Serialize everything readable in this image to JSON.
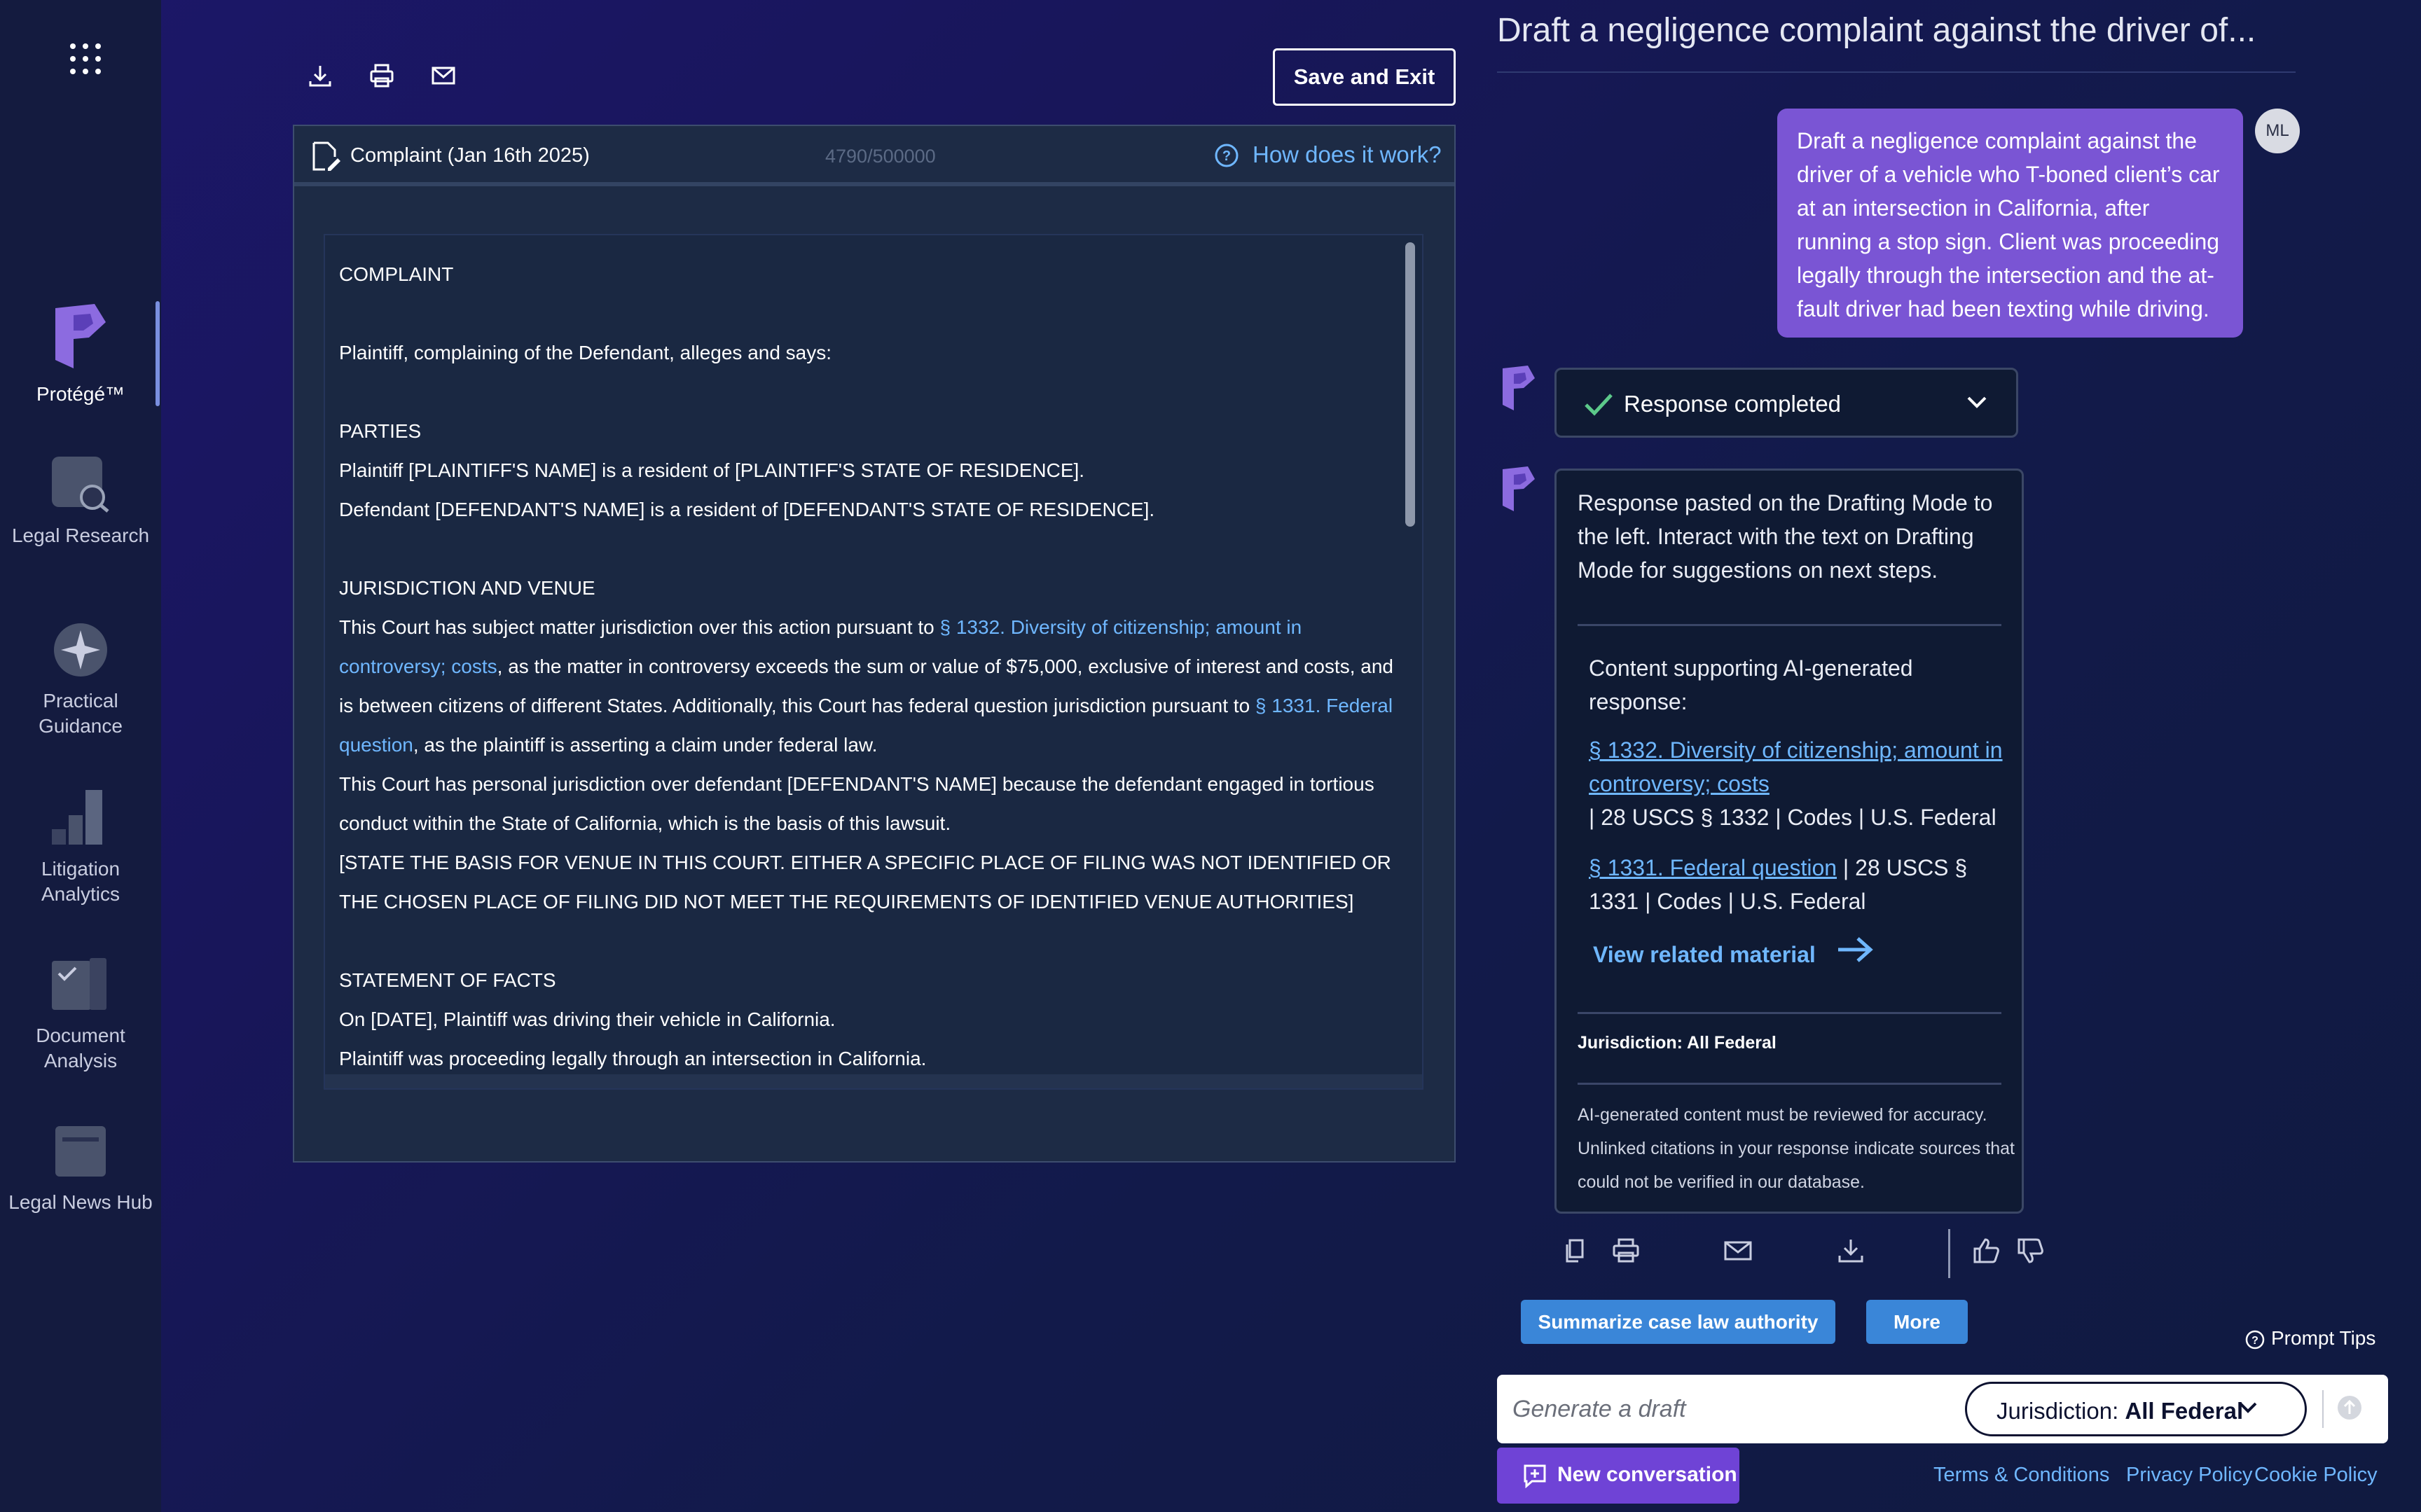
{
  "rail": {
    "items": [
      {
        "label": "Protégé™"
      },
      {
        "label": "Legal Research"
      },
      {
        "label": "Practical Guidance"
      },
      {
        "label": "Litigation Analytics"
      },
      {
        "label": "Document Analysis"
      },
      {
        "label": "Legal News Hub"
      }
    ]
  },
  "toolbar": {
    "download": "download-icon",
    "print": "print-icon",
    "email": "email-icon",
    "save_label": "Save and Exit"
  },
  "editor": {
    "doc_title": "Complaint (Jan 16th 2025)",
    "char_count": "4790/500000",
    "help_link": "How does it work?",
    "text": {
      "heading": "COMPLAINT",
      "intro": "Plaintiff, complaining of the Defendant, alleges and says:",
      "parties_heading": "PARTIES",
      "parties_1": "Plaintiff [PLAINTIFF'S NAME] is a resident of [PLAINTIFF'S STATE OF RESIDENCE].",
      "parties_2": "Defendant [DEFENDANT'S NAME] is a resident of [DEFENDANT'S STATE OF RESIDENCE].",
      "juris_heading": "JURISDICTION AND VENUE",
      "juris_p1_a": "This Court has subject matter jurisdiction over this action pursuant to ",
      "juris_p1_cite1": "§ 1332. Diversity of citizenship; amount in controversy; costs",
      "juris_p1_b": ", as the matter in controversy exceeds the sum or value of $75,000, exclusive of interest and costs, and is between citizens of different States. Additionally, this Court has federal question jurisdiction pursuant to ",
      "juris_p1_cite2": "§ 1331. Federal question",
      "juris_p1_c": ", as the plaintiff is asserting a claim under federal law.",
      "juris_p2": "This Court has personal jurisdiction over defendant [DEFENDANT'S NAME] because the defendant engaged in tortious conduct within the State of California, which is the basis of this lawsuit.",
      "juris_p3": "[STATE THE BASIS FOR VENUE IN THIS COURT. EITHER A SPECIFIC PLACE OF FILING WAS NOT IDENTIFIED OR THE CHOSEN PLACE OF FILING DID NOT MEET THE REQUIREMENTS OF IDENTIFIED VENUE AUTHORITIES]",
      "facts_heading": "STATEMENT OF FACTS",
      "facts_1": "On [DATE], Plaintiff was driving their vehicle in California.",
      "facts_2": "Plaintiff was proceeding legally through an intersection in California."
    }
  },
  "chat": {
    "title": "Draft a negligence complaint against the driver of...",
    "user_initials": "ML",
    "user_message": "Draft a negligence complaint against the driver of a vehicle who T-boned client’s car at an intersection in California, after running a stop sign. Client was proceeding legally through the intersection and the at-fault driver had been texting while driving.",
    "status": "Response completed",
    "response_message": "Response pasted on the Drafting Mode to the left. Interact with the text on Drafting Mode for suggestions on next steps.",
    "support_heading": "Content supporting AI-generated response:",
    "sources": [
      {
        "link": "§ 1332. Diversity of citizenship; amount in controversy; costs",
        "meta": "| 28 USCS § 1332 | Codes  | U.S. Federal"
      },
      {
        "link": "§ 1331. Federal question",
        "meta": " | 28 USCS § 1331 | Codes  | U.S. Federal"
      }
    ],
    "related_link": "View related material",
    "jurisdiction_note": "Jurisdiction: All Federal",
    "disclaimer": "AI-generated content must be reviewed for accuracy. Unlinked citations in your response indicate sources that could not be verified in our database.",
    "actions": [
      "copy-icon",
      "print-icon",
      "email-icon",
      "download-icon",
      "thumbs-up-icon",
      "thumbs-down-icon"
    ],
    "chips": [
      "Summarize case law authority",
      "More"
    ],
    "prompt_tips": "Prompt Tips",
    "composer_placeholder": "Generate a draft",
    "jurisdiction_label": "Jurisdiction:",
    "jurisdiction_value": "All Federal",
    "new_conversation": "New conversation"
  },
  "footer": {
    "links": [
      "Terms & Conditions",
      "Privacy Policy",
      "Cookie Policy"
    ]
  },
  "colors": {
    "accent_purple": "#7a55d4",
    "link_blue": "#6fb7ff",
    "chip_blue": "#3a86d8",
    "panel": "#0f1a33"
  }
}
